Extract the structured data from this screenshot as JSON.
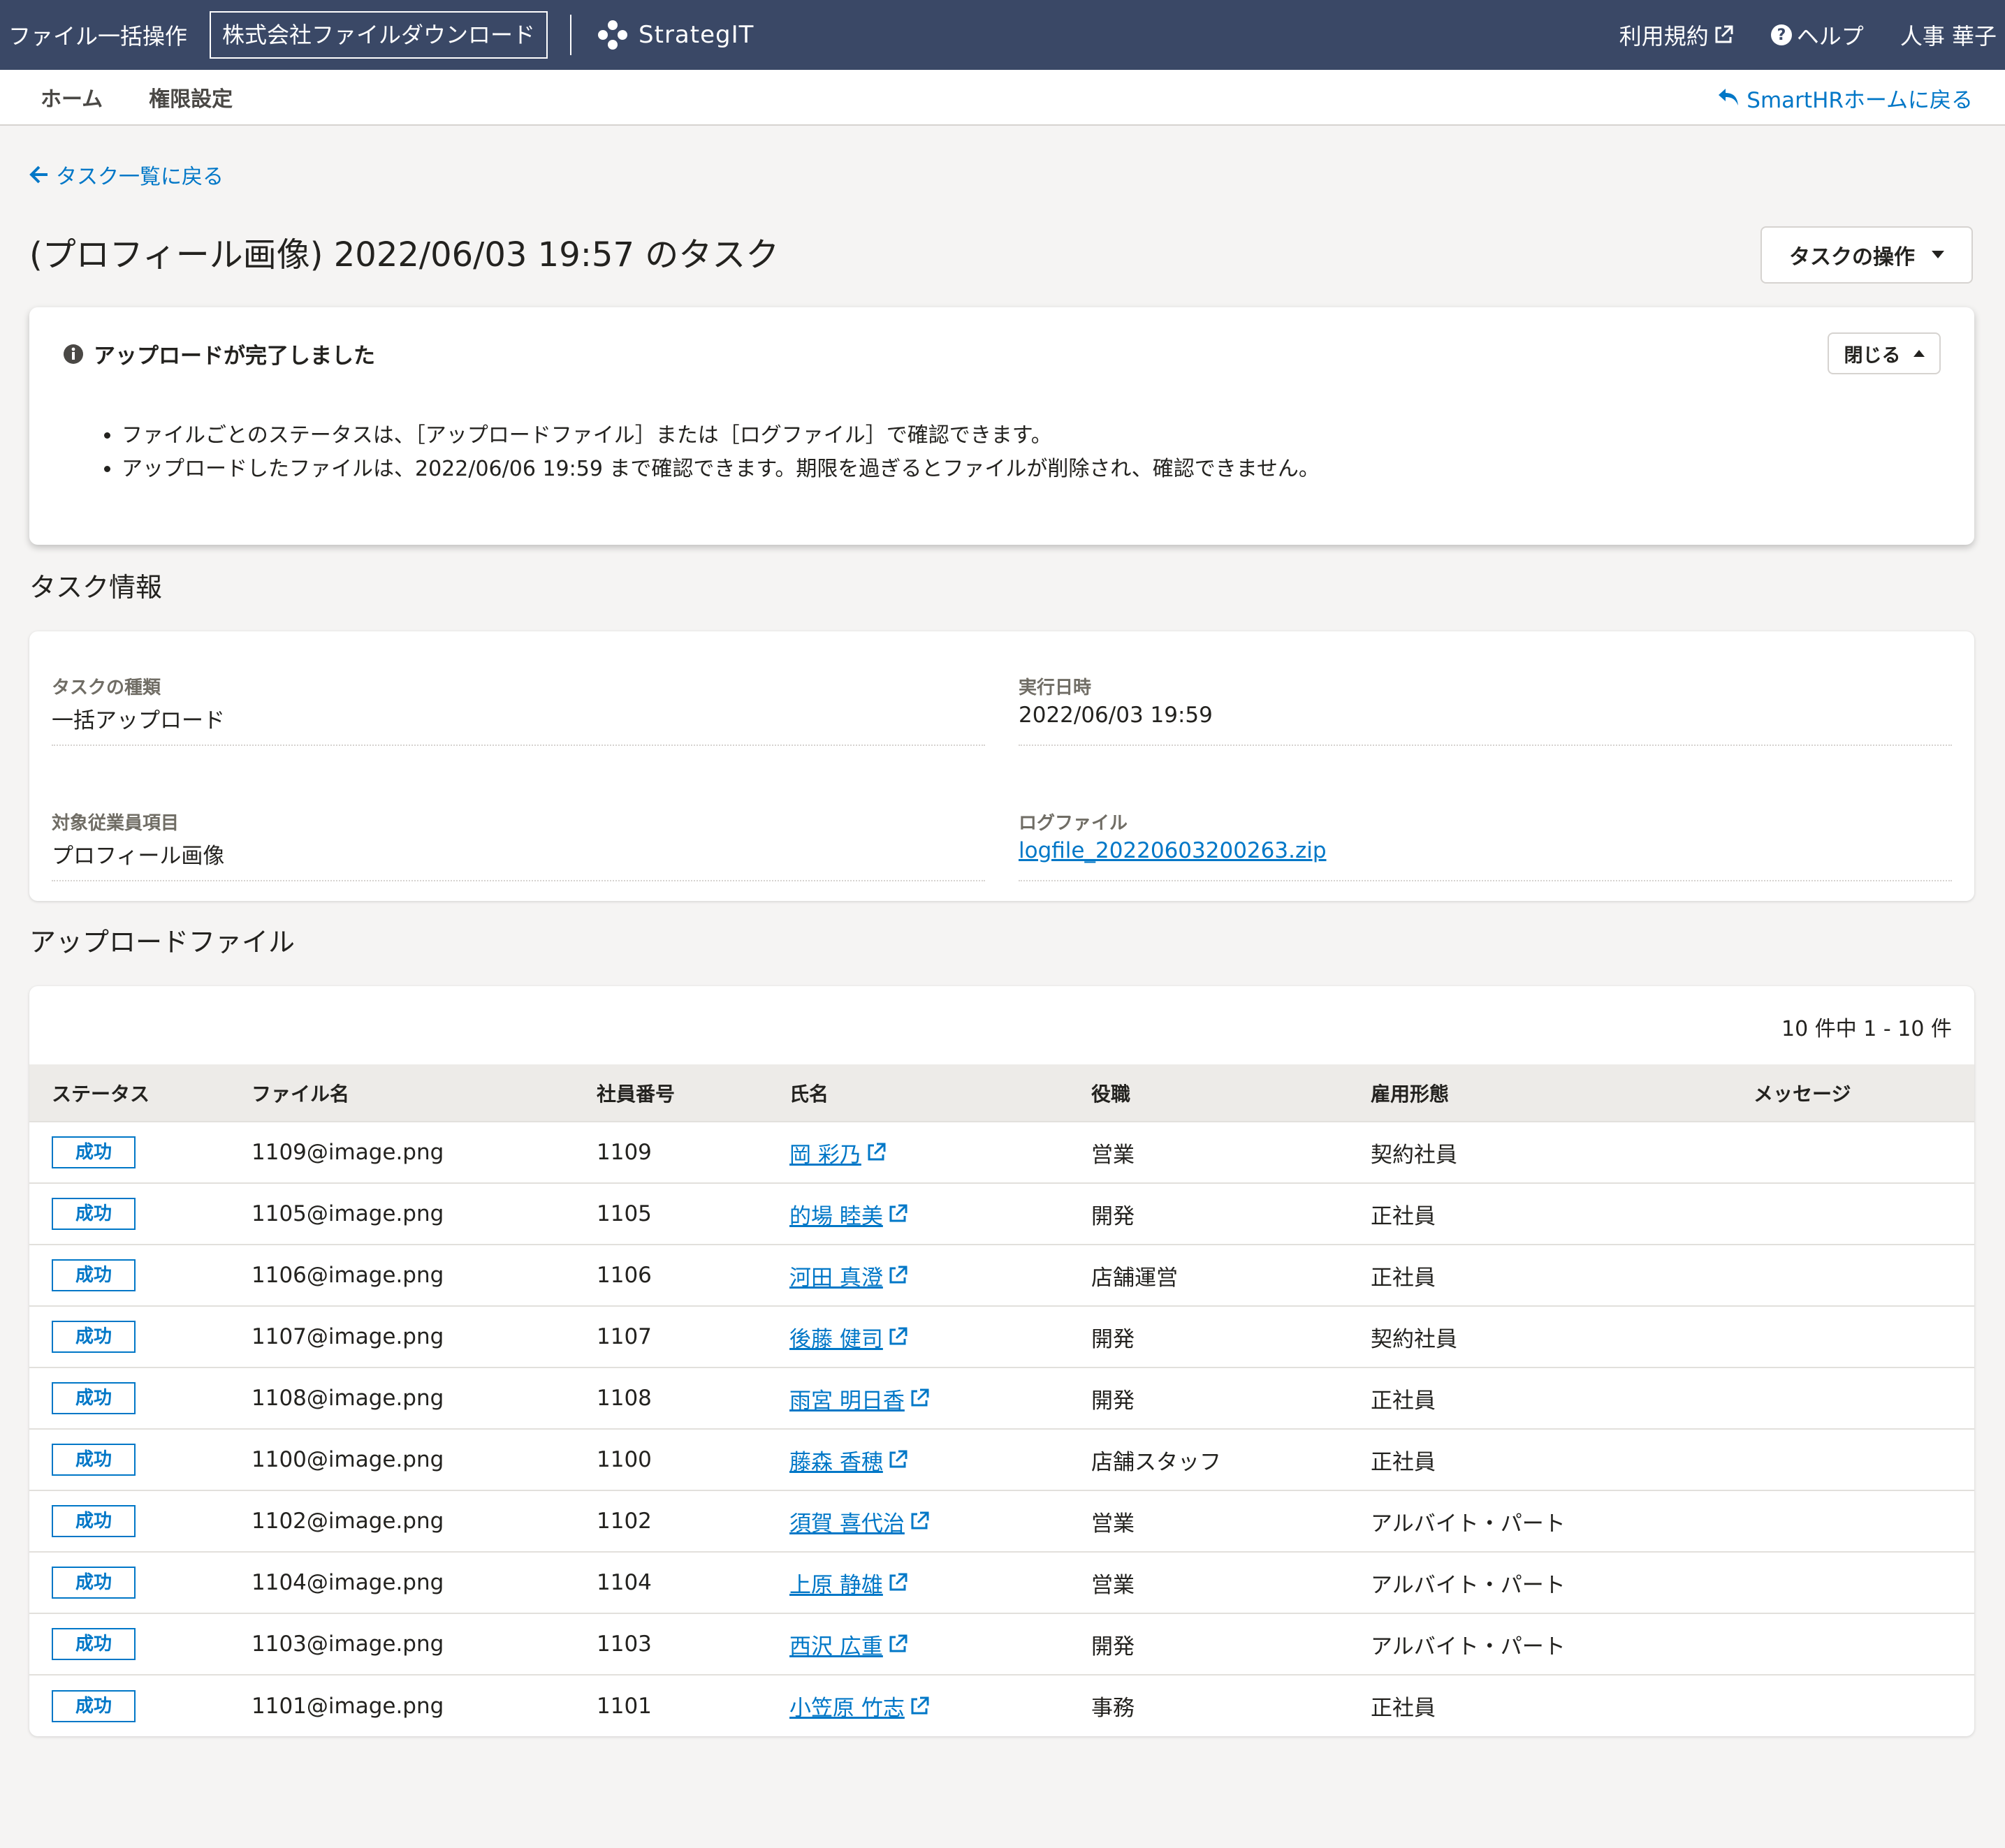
{
  "header": {
    "app_title": "ファイル一括操作",
    "tenant": "株式会社ファイルダウンロード",
    "logo_text": "StrategIT",
    "terms": "利用規約",
    "help": "ヘルプ",
    "user": "人事 華子"
  },
  "subnav": {
    "home": "ホーム",
    "permissions": "権限設定",
    "back_home": "SmartHRホームに戻る"
  },
  "back_link": "タスク一覧に戻る",
  "page_title": "(プロフィール画像) 2022/06/03 19:57 のタスク",
  "task_menu": "タスクの操作",
  "notice": {
    "title": "アップロードが完了しました",
    "close": "閉じる",
    "items": [
      "ファイルごとのステータスは、［アップロードファイル］または［ログファイル］で確認できます。",
      "アップロードしたファイルは、2022/06/06 19:59 まで確認できます。期限を過ぎるとファイルが削除され、確認できません。"
    ]
  },
  "task_info": {
    "section_title": "タスク情報",
    "type_label": "タスクの種類",
    "type_value": "一括アップロード",
    "date_label": "実行日時",
    "date_value": "2022/06/03 19:59",
    "target_label": "対象従業員項目",
    "target_value": "プロフィール画像",
    "log_label": "ログファイル",
    "log_value": "logfile_20220603200263.zip"
  },
  "files": {
    "section_title": "アップロードファイル",
    "count": "10 件中 1 - 10 件",
    "columns": [
      "ステータス",
      "ファイル名",
      "社員番号",
      "氏名",
      "役職",
      "雇用形態",
      "メッセージ"
    ],
    "rows": [
      {
        "status": "成功",
        "file": "1109@image.png",
        "id": "1109",
        "name": "岡 彩乃",
        "role": "営業",
        "employment": "契約社員",
        "message": ""
      },
      {
        "status": "成功",
        "file": "1105@image.png",
        "id": "1105",
        "name": "的場 睦美",
        "role": "開発",
        "employment": "正社員",
        "message": ""
      },
      {
        "status": "成功",
        "file": "1106@image.png",
        "id": "1106",
        "name": "河田 真澄",
        "role": "店舗運営",
        "employment": "正社員",
        "message": ""
      },
      {
        "status": "成功",
        "file": "1107@image.png",
        "id": "1107",
        "name": "後藤 健司",
        "role": "開発",
        "employment": "契約社員",
        "message": ""
      },
      {
        "status": "成功",
        "file": "1108@image.png",
        "id": "1108",
        "name": "雨宮 明日香",
        "role": "開発",
        "employment": "正社員",
        "message": ""
      },
      {
        "status": "成功",
        "file": "1100@image.png",
        "id": "1100",
        "name": "藤森 香穂",
        "role": "店舗スタッフ",
        "employment": "正社員",
        "message": ""
      },
      {
        "status": "成功",
        "file": "1102@image.png",
        "id": "1102",
        "name": "須賀 喜代治",
        "role": "営業",
        "employment": "アルバイト・パート",
        "message": ""
      },
      {
        "status": "成功",
        "file": "1104@image.png",
        "id": "1104",
        "name": "上原 静雄",
        "role": "営業",
        "employment": "アルバイト・パート",
        "message": ""
      },
      {
        "status": "成功",
        "file": "1103@image.png",
        "id": "1103",
        "name": "西沢 広重",
        "role": "開発",
        "employment": "アルバイト・パート",
        "message": ""
      },
      {
        "status": "成功",
        "file": "1101@image.png",
        "id": "1101",
        "name": "小笠原 竹志",
        "role": "事務",
        "employment": "正社員",
        "message": ""
      }
    ]
  },
  "colors": {
    "header_bg": "#3a4866",
    "link": "#0077c7",
    "page_bg": "#f5f4f3"
  }
}
